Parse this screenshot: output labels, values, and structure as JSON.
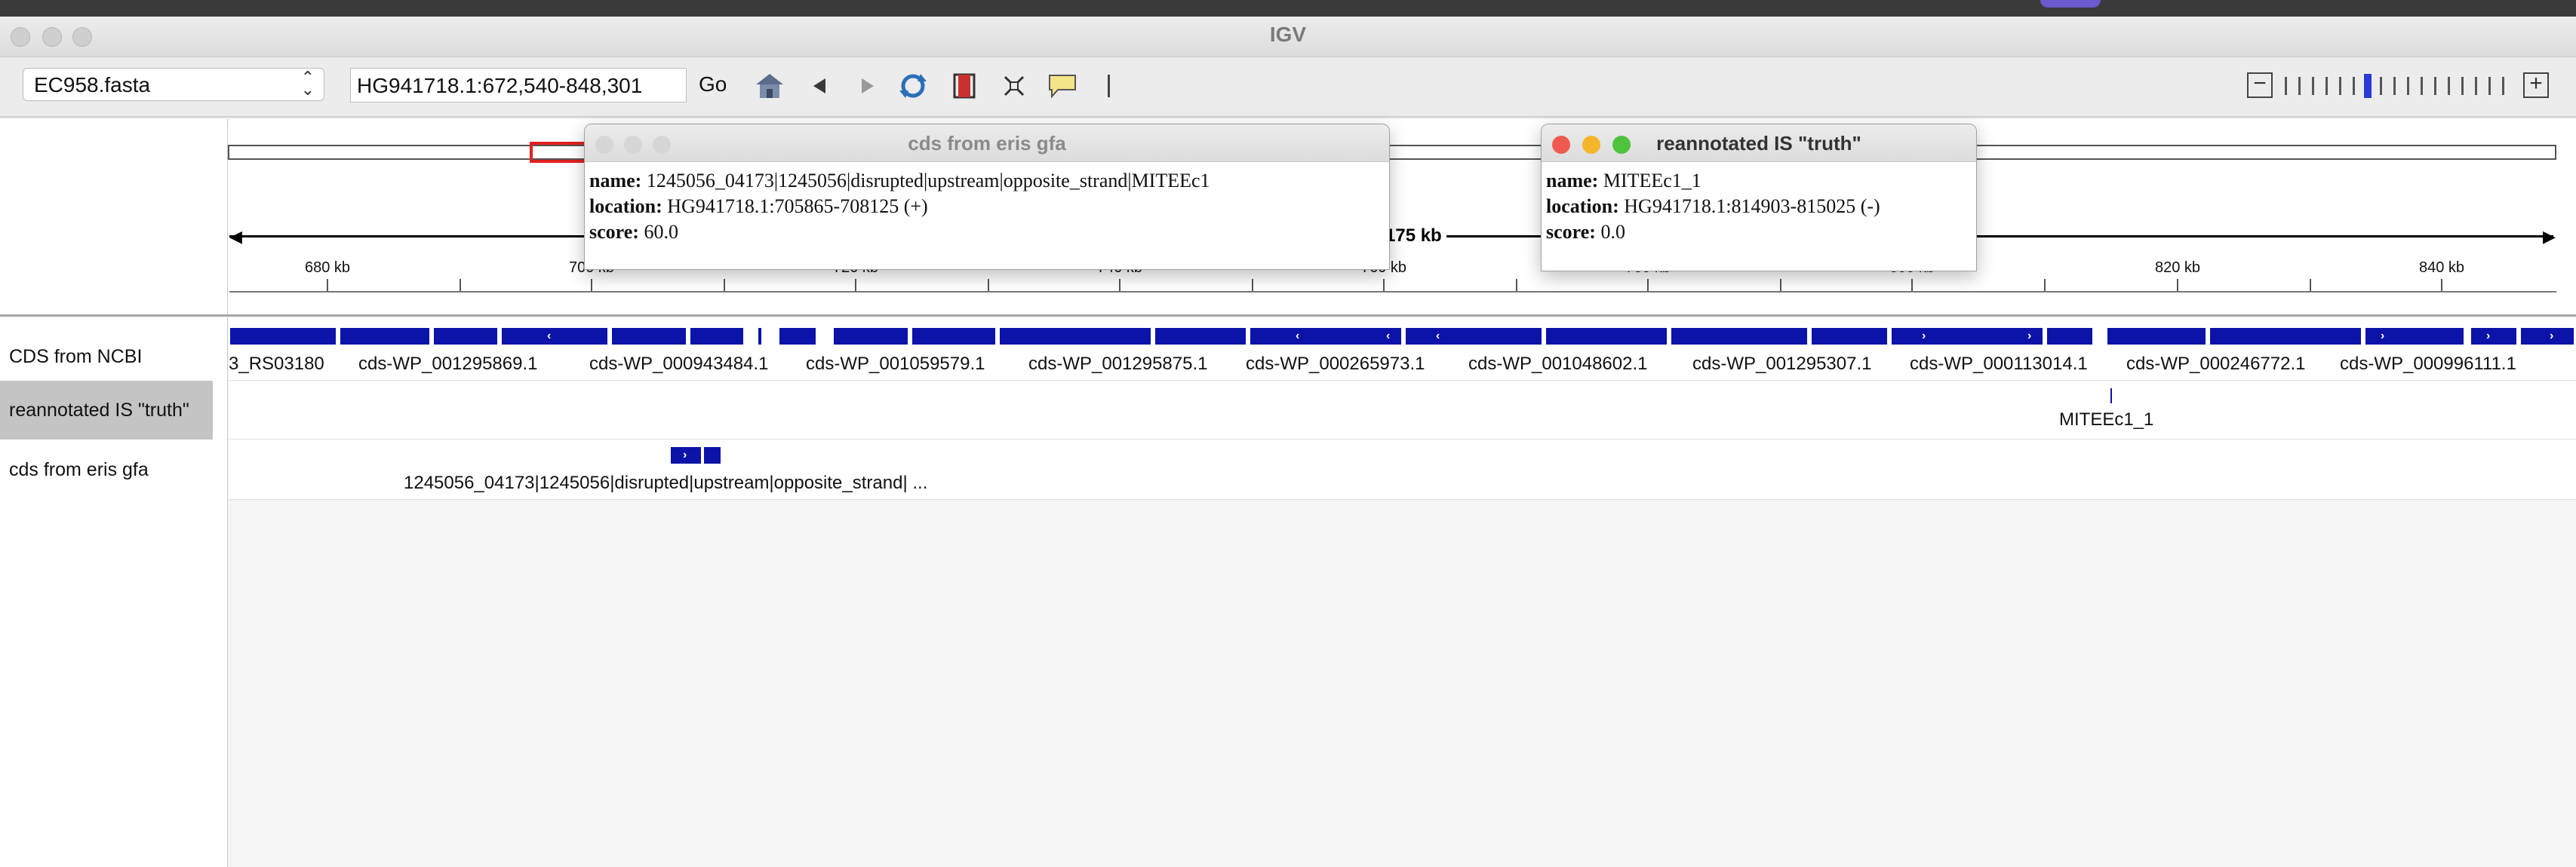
{
  "window": {
    "title": "IGV"
  },
  "toolbar": {
    "genome": "EC958.fasta",
    "locus": "HG941718.1:672,540-848,301",
    "go_label": "Go"
  },
  "ruler": {
    "scale_label": "175 kb",
    "ticks": [
      "680 kb",
      "700 kb",
      "720 kb",
      "740 kb",
      "760 kb",
      "780 kb",
      "800 kb",
      "820 kb",
      "840 kb"
    ]
  },
  "tracks": {
    "names": [
      "CDS from NCBI",
      "reannotated IS \"truth\"",
      "cds from eris gfa"
    ],
    "ncbi_labels": [
      "3_RS03180",
      "cds-WP_001295869.1",
      "cds-WP_000943484.1",
      "cds-WP_001059579.1",
      "cds-WP_001295875.1",
      "cds-WP_000265973.1",
      "cds-WP_001048602.1",
      "cds-WP_001295307.1",
      "cds-WP_000113014.1",
      "cds-WP_000246772.1",
      "cds-WP_000996111.1"
    ],
    "truth_label": "MITEEc1_1",
    "eris_label": "1245056_04173|1245056|disrupted|upstream|opposite_strand| ..."
  },
  "popup_eris": {
    "title": "cds from eris gfa",
    "name_key": "name:",
    "name_val": "1245056_04173|1245056|disrupted|upstream|opposite_strand|MITEEc1",
    "location_key": "location:",
    "location_val": "HG941718.1:705865-708125 (+)",
    "score_key": "score:",
    "score_val": "60.0"
  },
  "popup_truth": {
    "title": "reannotated IS \"truth\"",
    "name_key": "name:",
    "name_val": "MITEEc1_1",
    "location_key": "location:",
    "location_val": "HG941718.1:814903-815025 (-)",
    "score_key": "score:",
    "score_val": "0.0"
  },
  "colors": {
    "feature": "#0b13a8",
    "region_box": "#e02020",
    "zoom_thumb": "#2a3bd6"
  },
  "icons": [
    "home-icon",
    "back-icon",
    "forward-icon",
    "refresh-icon",
    "roi-icon",
    "fit-icon",
    "popup-icon",
    "ruler-divider-icon"
  ]
}
